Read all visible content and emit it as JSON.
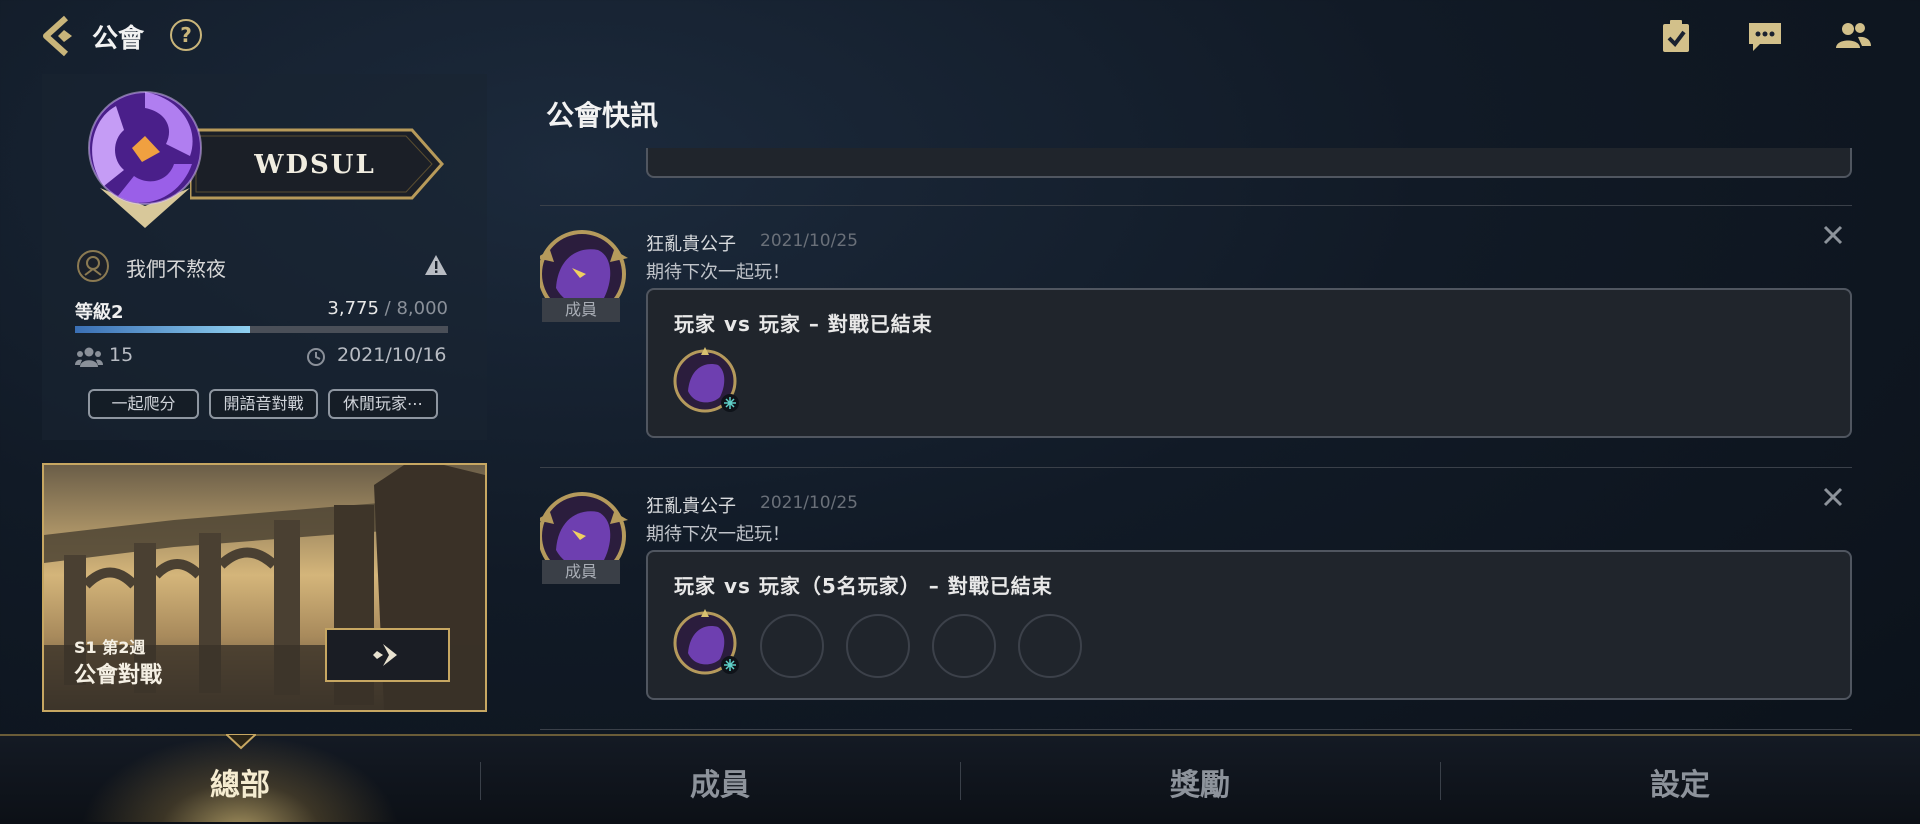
{
  "header": {
    "title": "公會",
    "help_glyph": "?",
    "icons": [
      "back-icon",
      "help-icon",
      "tasks-icon",
      "chat-icon",
      "friends-icon"
    ]
  },
  "guild": {
    "name": "WDSUL",
    "motto": "我們不熬夜",
    "level_label": "等級2",
    "xp_current": "3,775",
    "xp_separator": " / ",
    "xp_max": "8,000",
    "xp_progress": 0.47,
    "member_count": "15",
    "created_date": "2021/10/16",
    "tags": [
      "一起爬分",
      "開語音對戰",
      "休閒玩家⋯"
    ]
  },
  "clash": {
    "season": "S1 第2週",
    "title": "公會對戰"
  },
  "feed": {
    "title": "公會快訊",
    "posts": [
      {
        "author": "狂亂貴公子",
        "date": "2021/10/25",
        "message": "期待下次一起玩！",
        "role": "成員",
        "match_title": "玩家 vs 玩家 – 對戰已結束",
        "empty_slots": 0
      },
      {
        "author": "狂亂貴公子",
        "date": "2021/10/25",
        "message": "期待下次一起玩！",
        "role": "成員",
        "match_title": "玩家 vs 玩家（5名玩家） – 對戰已結束",
        "empty_slots": 4
      }
    ]
  },
  "nav": {
    "tabs": [
      "總部",
      "成員",
      "獎勵",
      "設定"
    ],
    "active": "總部"
  },
  "colors": {
    "accent_gold": "#c7a762",
    "xp_bar": "#8fd0f0",
    "emblem_purple": "#8a4fd8"
  }
}
